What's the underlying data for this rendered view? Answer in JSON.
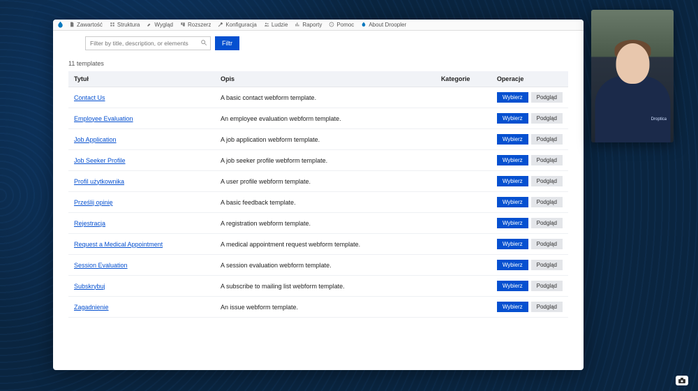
{
  "toolbar": {
    "items": [
      {
        "icon": "file",
        "label": "Zawartość"
      },
      {
        "icon": "struct",
        "label": "Struktura"
      },
      {
        "icon": "brush",
        "label": "Wygląd"
      },
      {
        "icon": "puzzle",
        "label": "Rozszerz"
      },
      {
        "icon": "wrench",
        "label": "Konfiguracja"
      },
      {
        "icon": "people",
        "label": "Ludzie"
      },
      {
        "icon": "chart",
        "label": "Raporty"
      },
      {
        "icon": "help",
        "label": "Pomoc"
      },
      {
        "icon": "drop",
        "label": "About Droopler"
      }
    ]
  },
  "filter": {
    "placeholder": "Filter by title, description, or elements",
    "button": "Filtr"
  },
  "count_text": "11 templates",
  "columns": {
    "title": "Tytuł",
    "desc": "Opis",
    "cat": "Kategorie",
    "ops": "Operacje"
  },
  "ops": {
    "select": "Wybierz",
    "preview": "Podgląd"
  },
  "rows": [
    {
      "title": "Contact Us",
      "desc": "A basic contact webform template."
    },
    {
      "title": "Employee Evaluation",
      "desc": "An employee evaluation webform template."
    },
    {
      "title": "Job Application",
      "desc": "A job application webform template."
    },
    {
      "title": "Job Seeker Profile",
      "desc": "A job seeker profile webform template."
    },
    {
      "title": "Profil użytkownika",
      "desc": "A user profile webform template."
    },
    {
      "title": "Prześlij opinię",
      "desc": "A basic feedback template."
    },
    {
      "title": "Rejestracja",
      "desc": "A registration webform template."
    },
    {
      "title": "Request a Medical Appointment",
      "desc": "A medical appointment request webform template."
    },
    {
      "title": "Session Evaluation",
      "desc": "A session evaluation webform template."
    },
    {
      "title": "Subskrybuj",
      "desc": "A subscribe to mailing list webform template."
    },
    {
      "title": "Zagadnienie",
      "desc": "An issue webform template."
    }
  ],
  "webcam": {
    "badge": "Droptica"
  }
}
